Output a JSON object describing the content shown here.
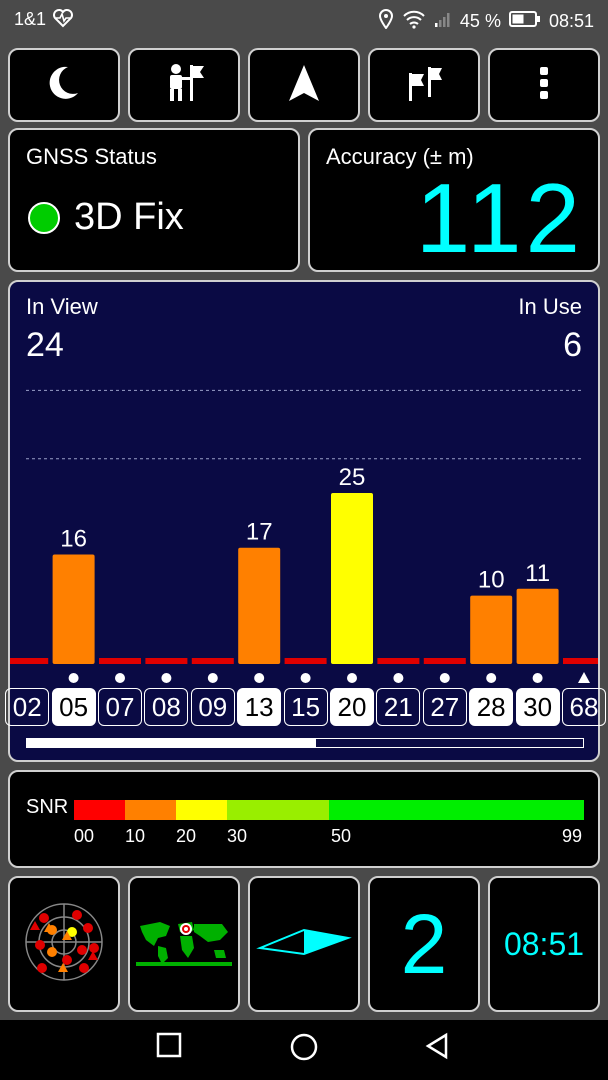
{
  "status_bar": {
    "carrier": "1&1",
    "battery_percent": "45 %",
    "time": "08:51"
  },
  "toolbar": {
    "buttons": [
      {
        "icon": "moon-icon"
      },
      {
        "icon": "person-flag-icon"
      },
      {
        "icon": "navigation-arrow-icon"
      },
      {
        "icon": "flags-icon"
      },
      {
        "icon": "more-vert-icon"
      }
    ]
  },
  "gnss_status": {
    "label": "GNSS Status",
    "fix": "3D Fix",
    "indicator_color": "#00cc00"
  },
  "accuracy": {
    "label": "Accuracy (± m)",
    "value": "112"
  },
  "satellites": {
    "in_view_label": "In View",
    "in_view": "24",
    "in_use_label": "In Use",
    "in_use": "6"
  },
  "chart_data": {
    "type": "bar",
    "categories": [
      "02",
      "05",
      "07",
      "08",
      "09",
      "13",
      "15",
      "20",
      "21",
      "27",
      "28",
      "30",
      "68"
    ],
    "values": [
      0,
      16,
      0,
      0,
      0,
      17,
      0,
      25,
      0,
      0,
      10,
      11,
      0
    ],
    "value_labels": [
      "",
      "16",
      "",
      "",
      "",
      "17",
      "",
      "25",
      "",
      "",
      "10",
      "11",
      ""
    ],
    "used": [
      false,
      true,
      false,
      false,
      false,
      true,
      false,
      true,
      false,
      false,
      true,
      true,
      false
    ],
    "markers": [
      "",
      "dot",
      "dot",
      "dot",
      "dot",
      "dot",
      "dot",
      "dot",
      "dot",
      "dot",
      "dot",
      "dot",
      "triangle"
    ],
    "colors": {
      "unused": "#e00000",
      "mid": "#ff8000",
      "high": "#ffff00"
    },
    "ylim": [
      0,
      50
    ]
  },
  "snr_legend": {
    "label": "SNR",
    "ticks": [
      "00",
      "10",
      "20",
      "30",
      "50",
      "99"
    ],
    "segments": [
      {
        "color": "#ff0000"
      },
      {
        "color": "#ff8000"
      },
      {
        "color": "#ffff00"
      },
      {
        "color": "#99ee00"
      },
      {
        "color": "#00ee00"
      }
    ]
  },
  "bottom_tiles": {
    "sky_icon": "sky-plot-icon",
    "map_icon": "world-map-icon",
    "compass_icon": "compass-arrow-icon",
    "number": "2",
    "time": "08:51"
  },
  "nav": {
    "recent_icon": "square-icon",
    "home_icon": "circle-icon",
    "back_icon": "triangle-back-icon"
  }
}
